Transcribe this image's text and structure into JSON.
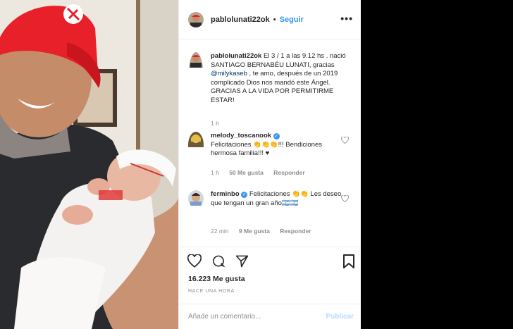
{
  "post": {
    "username": "pablolunati22ok",
    "follow_label": "Seguir",
    "separator": "•",
    "more_label": "•••"
  },
  "caption": {
    "username": "pablolunati22ok",
    "text": "El 3 / 1 a las 9.12 hs . nació SANTIAGO BERNABÉU LUNATI, gracias ",
    "mention": "@milykaseb",
    "text2": " , te amo, después de un 2019 complicado Dios nos mandó este Ángel. GRACIAS A LA VIDA POR PERMITIRME ESTAR!",
    "age": "1 h"
  },
  "comments": [
    {
      "username": "melody_toscanook",
      "text": "Felicitaciones 👏👏👏!!! Bendiciones hermosa familia!!! ♥",
      "age": "1 h",
      "likes": "50 Me gusta",
      "reply": "Responder"
    },
    {
      "username": "ferminbo",
      "text": "Felicitaciones 👏👏 Les deseo que tengan un gran año🇦🇷🇦🇷",
      "age": "22 min",
      "likes": "9 Me gusta",
      "reply": "Responder"
    }
  ],
  "footer": {
    "likes": "16.223 Me gusta",
    "time": "HACE UNA HORA",
    "comment_placeholder": "Añade un comentario...",
    "publish_label": "Publicar"
  },
  "icons": [
    "heart-icon",
    "comment-icon",
    "share-icon",
    "bookmark-icon",
    "verified-icon",
    "more-icon"
  ],
  "colors": {
    "link": "#3897f0",
    "meta": "#8e8e8e",
    "publish_disabled": "#b3dbff",
    "cap_red": "#e8202a"
  }
}
